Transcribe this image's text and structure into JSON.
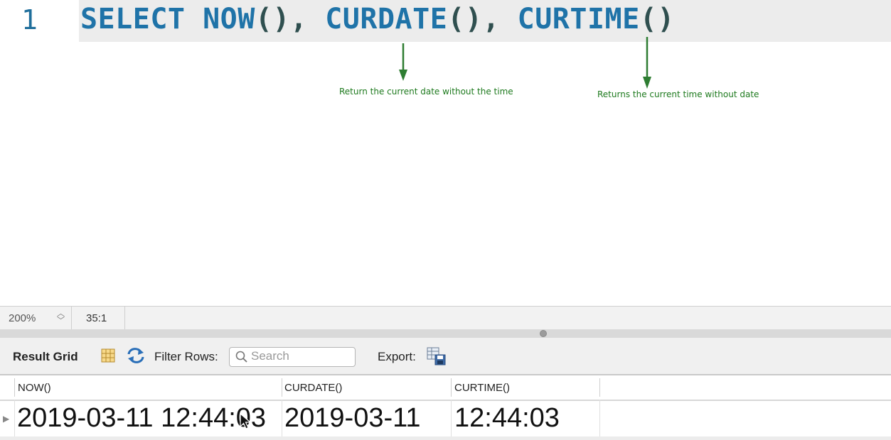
{
  "editor": {
    "line_number": "1",
    "code": {
      "keyword": "SELECT",
      "fn1": "NOW",
      "fn2": "CURDATE",
      "fn3": "CURTIME",
      "parens": "()",
      "comma": ","
    },
    "annotations": {
      "curdate": "Return the current date without the time",
      "curtime": "Returns the current time without date"
    },
    "annotation_color": "#1e7a1e"
  },
  "statusbar": {
    "zoom": "200%",
    "position": "35:1"
  },
  "toolbar": {
    "title": "Result Grid",
    "filter_label": "Filter Rows:",
    "search_placeholder": "Search",
    "export_label": "Export:",
    "icons": [
      "grid-columns-icon",
      "refresh-icon",
      "search-icon",
      "export-icon"
    ]
  },
  "result_grid": {
    "columns": [
      "NOW()",
      "CURDATE()",
      "CURTIME()"
    ],
    "rows": [
      [
        "2019-03-11 12:44:03",
        "2019-03-11",
        "12:44:03"
      ]
    ]
  }
}
